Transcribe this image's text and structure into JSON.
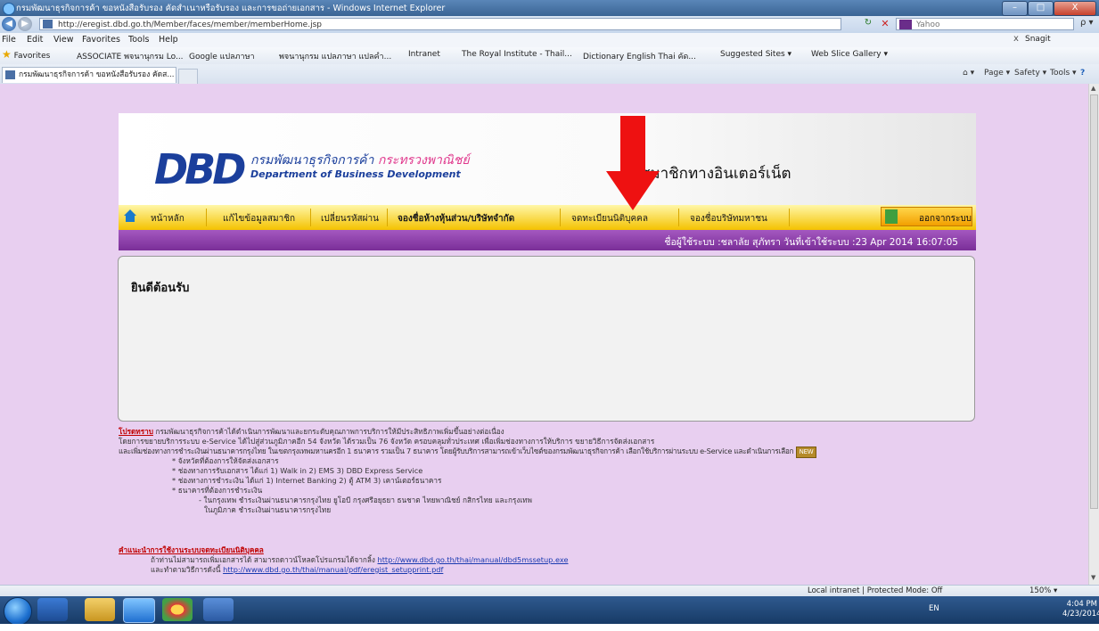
{
  "window": {
    "title": "กรมพัฒนาธุรกิจการค้า ขอหนังสือรับรอง คัดสำเนาหรือรับรอง และการขอถ่ายเอกสาร - Windows Internet Explorer",
    "minimize": "–",
    "maximize": "□",
    "close": "X"
  },
  "address_bar": {
    "url": "http://eregist.dbd.go.th/Member/faces/member/memberHome.jsp",
    "search_placeholder": "Yahoo",
    "search_go": "ρ ▾"
  },
  "menu": {
    "items": [
      "File",
      "Edit",
      "View",
      "Favorites",
      "Tools",
      "Help"
    ],
    "close": "x",
    "snagit": "Snagit"
  },
  "favorites": {
    "label": "Favorites",
    "items": [
      "ASSOCIATE พจนานุกรม Lo...",
      "Google แปลภาษา",
      "พจนานุกรม แปลภาษา แปลคำ...",
      "Intranet",
      "The Royal Institute - Thail...",
      "Dictionary English Thai คัด...",
      "Suggested Sites ▾",
      "Web Slice Gallery ▾"
    ]
  },
  "tab": {
    "title": "กรมพัฒนาธุรกิจการค้า ขอหนังสือรับรอง คัดส..."
  },
  "commands": {
    "page": "Page ▾",
    "safety": "Safety ▾",
    "tools": "Tools ▾"
  },
  "site": {
    "logo": "DBD",
    "dept_th_part1": "กรมพัฒนาธุรกิจการค้า",
    "dept_th_part2": "กระทรวงพาณิชย์",
    "dept_en": "Department of Business Development",
    "member_title": "สมาชิกทางอินเตอร์เน็ต",
    "nav": {
      "home": "หน้าหลัก",
      "edit_member": "แก้ไขข้อมูลสมาชิก",
      "change_password": "เปลี่ยนรหัสผ่าน",
      "reserve_name": "จองชื่อห้างหุ้นส่วน/บริษัทจำกัด",
      "register_juristic": "จดทะเบียนนิติบุคคล",
      "reserve_public": "จองชื่อบริษัทมหาชน",
      "logout": "ออกจากระบบ"
    },
    "user_info": "ชื่อผู้ใช้ระบบ :ชลาลัย สุภัทรา   วันที่เข้าใช้ระบบ :23 Apr 2014 16:07:05",
    "welcome": "ยินดีต้อนรับ",
    "announce": {
      "notice_label": "โปรดทราบ",
      "line1": "กรมพัฒนาธุรกิจการค้าได้ดำเนินการพัฒนาและยกระดับคุณภาพการบริการให้มีประสิทธิภาพเพิ่มขึ้นอย่างต่อเนื่อง",
      "line2": "โดยการขยายบริการระบบ e-Service ได้ไปสู่ส่วนภูมิภาคอีก 54 จังหวัด ได้รวมเป็น 76 จังหวัด ครอบคลุมทั่วประเทศ เพื่อเพิ่มช่องทางการให้บริการ ขยายวิธีการจัดส่งเอกสาร",
      "line3": "และเพิ่มช่องทางการชำระเงินผ่านธนาคารกรุงไทย ในเขตกรุงเทพมหานครอีก 1 ธนาคาร รวมเป็น 7 ธนาคาร โดยผู้รับบริการสามารถเข้าเว็บไซต์ของกรมพัฒนาธุรกิจการค้า เลือกใช้บริการผ่านระบบ e-Service และดำเนินการเลือก",
      "new_badge": "NEW",
      "line4": "* จังหวัดที่ต้องการให้จัดส่งเอกสาร",
      "line5": "* ช่องทางการรับเอกสาร ได้แก่ 1) Walk in 2) EMS 3) DBD Express Service",
      "line6": "* ช่องทางการชำระเงิน ได้แก่ 1) Internet Banking 2) ตู้ ATM 3) เคาน์เตอร์ธนาคาร",
      "line7": "* ธนาคารที่ต้องการชำระเงิน",
      "line8": "- ในกรุงเทพ ชำระเงินผ่านธนาคารกรุงไทย ยูโอบี กรุงศรีอยุธยา ธนชาต ไทยพาณิชย์ กสิกรไทย และกรุงเทพ",
      "line9": "ในภูมิภาค ชำระเงินผ่านธนาคารกรุงไทย",
      "guide_title": "คำแนะนำการใช้งานระบบจดทะเบียนนิติบุคคล",
      "guide1_text": "ถ้าท่านไม่สามารถเพิ่มเอกสารได้ สามารถดาวน์โหลดโปรแกรมได้จากลิ้ง",
      "guide1_link": "http://www.dbd.go.th/thai/manual/dbd5mssetup.exe",
      "guide2_text": "และทำตามวิธีการดังนี้",
      "guide2_link": "http://www.dbd.go.th/thai/manual/pdf/eregist_setupprint.pdf"
    }
  },
  "status": {
    "zone": "Local intranet | Protected Mode: Off",
    "zoom": "150% ▾"
  },
  "taskbar": {
    "tray_text": "EN",
    "time": "4:04 PM",
    "date": "4/23/2014"
  },
  "colors": {
    "page_bg": "#e8cff0",
    "nav_yellow": "#f4c200",
    "user_bar_purple": "#7a2e98",
    "brand_blue": "#1b3f9c",
    "arrow_red": "#ee1111"
  }
}
